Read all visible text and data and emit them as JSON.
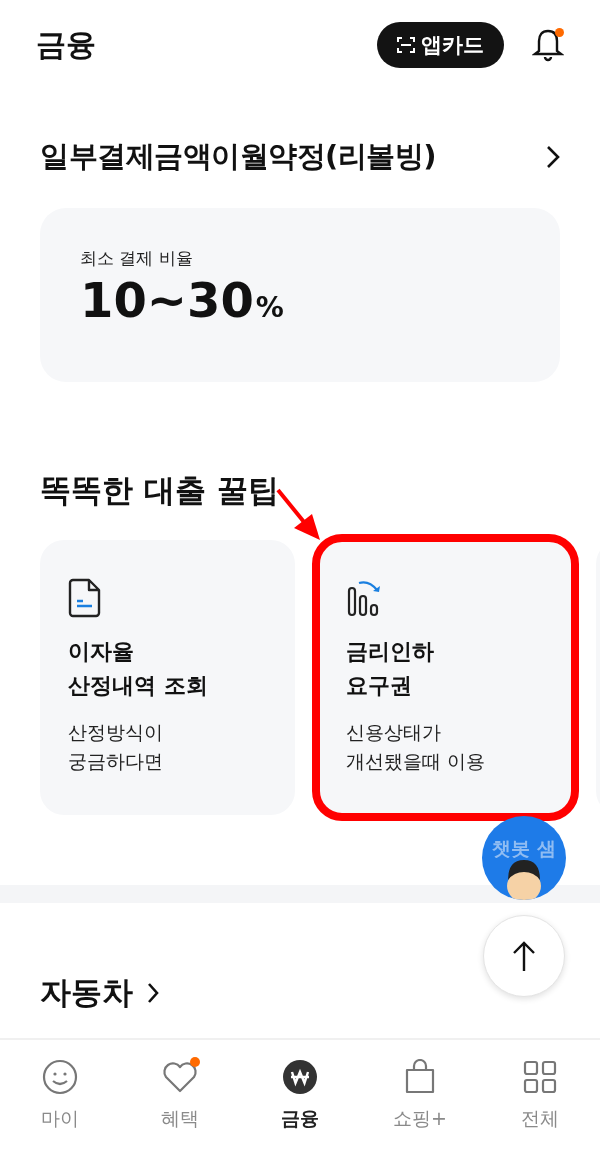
{
  "header": {
    "title": "금융",
    "app_card_button": "앱카드",
    "notification_badge": true
  },
  "revolving": {
    "title": "일부결제금액이월약정(리볼빙)",
    "label": "최소 결제 비율",
    "value": "10~30",
    "unit": "%"
  },
  "tips": {
    "title": "똑똑한 대출 꿀팁",
    "cards": [
      {
        "kind": "document",
        "title": "이자율\n산정내역 조회",
        "description": "산정방식이\n궁금하다면",
        "highlighted": false
      },
      {
        "kind": "rate-down",
        "title": "금리인하\n요구권",
        "description": "신용상태가\n개선됐을때 이용",
        "highlighted": true
      }
    ]
  },
  "chatbot": {
    "label": "챗봇 샘"
  },
  "car": {
    "title": "자동차"
  },
  "nav": [
    {
      "kind": "face",
      "label": "마이",
      "selected": false,
      "badge": false
    },
    {
      "kind": "heart",
      "label": "혜택",
      "selected": false,
      "badge": true
    },
    {
      "kind": "won",
      "label": "금융",
      "selected": true,
      "badge": false
    },
    {
      "kind": "bag",
      "label": "쇼핑+",
      "selected": false,
      "badge": false
    },
    {
      "kind": "grid",
      "label": "전체",
      "selected": false,
      "badge": false
    }
  ]
}
